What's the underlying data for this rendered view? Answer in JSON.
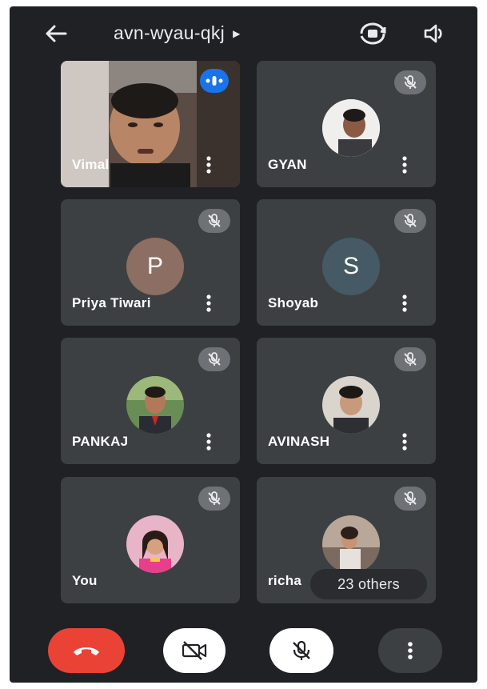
{
  "header": {
    "meeting_code": "avn-wyau-qkj",
    "icons": {
      "back": "arrow-left-icon",
      "caret": "caret-right-icon",
      "flip": "camera-flip-icon",
      "speaker": "speaker-icon"
    }
  },
  "participants": [
    {
      "name": "Vimal",
      "avatar": "video",
      "muted": false,
      "speaking": true
    },
    {
      "name": "GYAN",
      "avatar": "photo",
      "muted": true
    },
    {
      "name": "Priya Tiwari",
      "avatar": "letter",
      "letter": "P",
      "avatar_color": "#8d6e63",
      "muted": true
    },
    {
      "name": "Shoyab",
      "avatar": "letter",
      "letter": "S",
      "avatar_color": "#455a64",
      "muted": true
    },
    {
      "name": "PANKAJ",
      "avatar": "photo",
      "muted": true
    },
    {
      "name": "AVINASH",
      "avatar": "photo",
      "muted": true
    },
    {
      "name": "You",
      "avatar": "photo",
      "muted": true
    },
    {
      "name": "richa",
      "avatar": "photo",
      "muted": true
    }
  ],
  "others_pill": {
    "label": "23 others"
  },
  "controls": {
    "end_call": {
      "icon": "phone-hangup-icon",
      "color": "#ea4335"
    },
    "camera": {
      "icon": "camera-off-icon"
    },
    "microphone": {
      "icon": "mic-off-icon"
    },
    "more": {
      "icon": "more-vert-icon"
    }
  },
  "colors": {
    "background": "#202124",
    "tile": "#3c4043",
    "speaking_badge": "#1a73e8"
  }
}
